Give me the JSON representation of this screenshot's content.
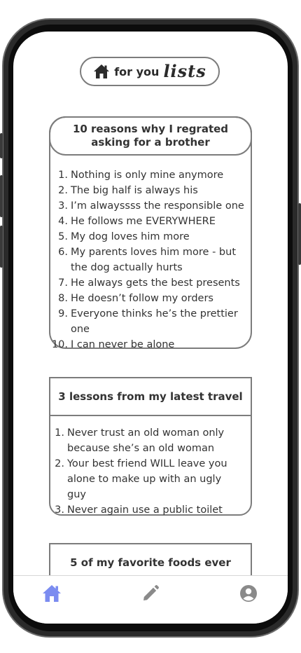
{
  "colors": {
    "accent": "#7b8cf0",
    "icon_gray": "#8a8a8a",
    "border": "#7c7c7c"
  },
  "header": {
    "home_icon": "home-icon",
    "for_you": "for you",
    "lists": "lists"
  },
  "cards": [
    {
      "title": "10 reasons why I regrated asking for a brother",
      "items": [
        {
          "num": "1.",
          "text": "Nothing is only mine anymore"
        },
        {
          "num": "2.",
          "text": "The big half is always his"
        },
        {
          "num": "3.",
          "text": "I’m alwayssss the responsible one"
        },
        {
          "num": "4.",
          "text": "He follows me EVERYWHERE"
        },
        {
          "num": "5.",
          "text": "My dog loves him more"
        },
        {
          "num": "6.",
          "text": "My parents loves him more - but the dog actually hurts"
        },
        {
          "num": "7.",
          "text": "He always gets the best presents"
        },
        {
          "num": "8.",
          "text": "He doesn’t follow my orders"
        },
        {
          "num": "9.",
          "text": "Everyone thinks he’s the prettier one"
        },
        {
          "num": "10.",
          "text": "I can never be alone"
        }
      ]
    },
    {
      "title": "3 lessons from my latest travel",
      "items": [
        {
          "num": "1.",
          "text": "Never trust an old woman only because she’s an old woman"
        },
        {
          "num": "2.",
          "text": "Your best friend WILL leave you alone to make up with an ugly guy"
        },
        {
          "num": "3.",
          "text": "Never again use a public toilet"
        }
      ]
    },
    {
      "title": "5 of my favorite foods ever"
    }
  ],
  "nav": {
    "home_icon": "home-icon",
    "edit_icon": "pencil-icon",
    "profile_icon": "user-circle-icon",
    "active": "home"
  }
}
